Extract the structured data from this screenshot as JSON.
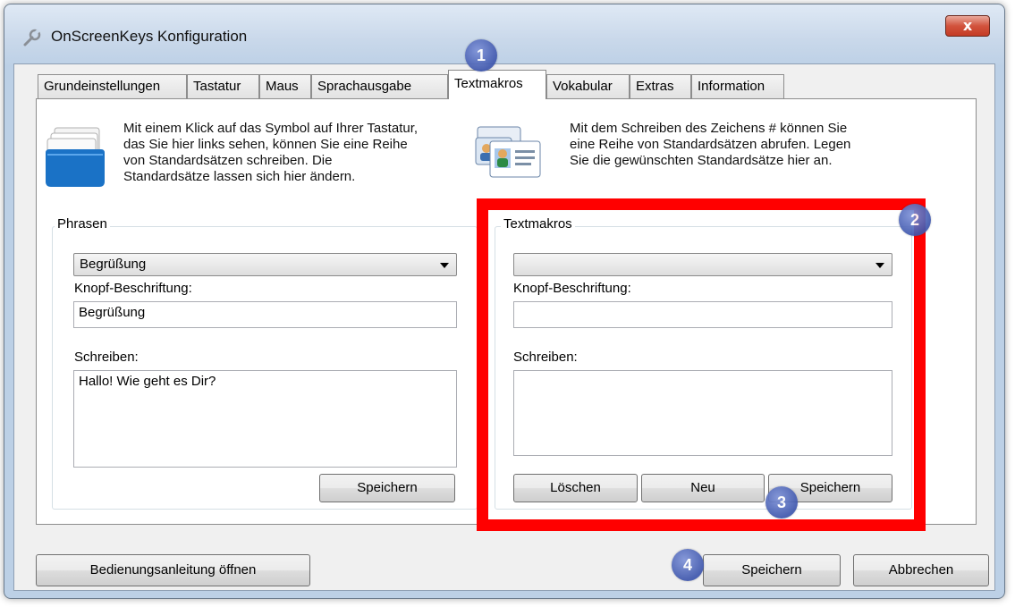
{
  "window": {
    "title": "OnScreenKeys Konfiguration",
    "close_label": "x"
  },
  "tabs": [
    {
      "label": "Grundeinstellungen"
    },
    {
      "label": "Tastatur"
    },
    {
      "label": "Maus"
    },
    {
      "label": "Sprachausgabe"
    },
    {
      "label": "Textmakros"
    },
    {
      "label": "Vokabular"
    },
    {
      "label": "Extras"
    },
    {
      "label": "Information"
    }
  ],
  "active_tab": "Textmakros",
  "left": {
    "description_lines": [
      "Mit einem Klick auf das Symbol auf Ihrer Tastatur,",
      "das Sie hier links sehen, können Sie eine Reihe",
      "von Standardsätzen schreiben. Die",
      "Standardsätze lassen sich hier ändern."
    ],
    "group_title": "Phrasen",
    "combo_value": "Begrüßung",
    "caption_label": "Knopf-Beschriftung:",
    "caption_value": "Begrüßung",
    "write_label": "Schreiben:",
    "write_value": "Hallo! Wie geht es Dir?",
    "save_label": "Speichern"
  },
  "right": {
    "description_lines": [
      "Mit dem Schreiben des Zeichens # können Sie",
      "eine Reihe von Standardsätzen abrufen. Legen",
      "Sie die gewünschten Standardsätze hier an."
    ],
    "group_title": "Textmakros",
    "combo_value": "",
    "caption_label": "Knopf-Beschriftung:",
    "caption_value": "",
    "write_label": "Schreiben:",
    "write_value": "",
    "delete_label": "Löschen",
    "new_label": "Neu",
    "save_label": "Speichern"
  },
  "footer": {
    "manual_label": "Bedienungsanleitung öffnen",
    "save_label": "Speichern",
    "cancel_label": "Abbrechen"
  },
  "markers": [
    "1",
    "2",
    "3",
    "4"
  ],
  "colors": {
    "highlight": "#ff0000",
    "marker": "#3f57ad"
  },
  "icons": {
    "title": "wrench-icon",
    "left": "folder-stack-icon",
    "right": "contact-cards-icon"
  }
}
